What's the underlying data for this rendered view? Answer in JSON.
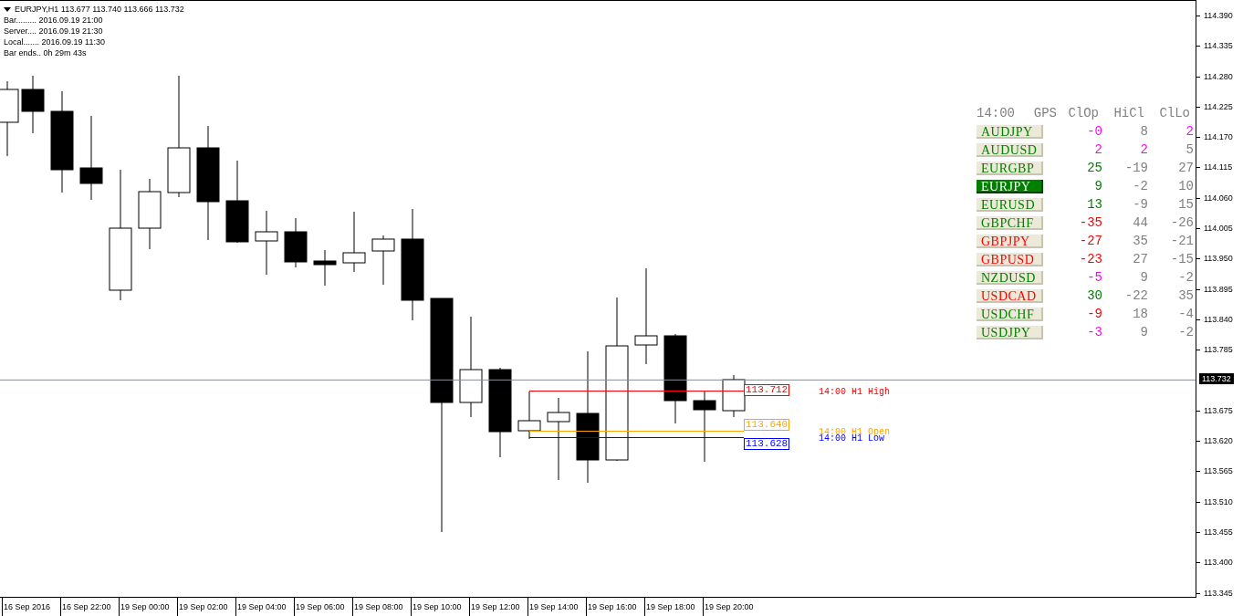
{
  "chart_header": {
    "title": "EURJPY,H1  113.677 113.740 113.666 113.732"
  },
  "info_lines": [
    "Bar......... 2016.09.19 21:00",
    "Server.... 2016.09.19 21:30",
    "Local....... 2016.09.19 11:30",
    "Bar ends.. 0h 29m 43s"
  ],
  "price_axis": {
    "labels": [
      "114.390",
      "114.335",
      "114.280",
      "114.225",
      "114.170",
      "114.115",
      "114.060",
      "114.005",
      "113.950",
      "113.895",
      "113.840",
      "113.785",
      "113.675",
      "113.620",
      "113.565",
      "113.510",
      "113.455",
      "113.400",
      "113.345"
    ],
    "current_price": "113.732"
  },
  "time_axis": [
    "16 Sep 2016",
    "16 Sep 22:00",
    "19 Sep 00:00",
    "19 Sep 02:00",
    "19 Sep 04:00",
    "19 Sep 06:00",
    "19 Sep 08:00",
    "19 Sep 10:00",
    "19 Sep 12:00",
    "19 Sep 14:00",
    "19 Sep 16:00",
    "19 Sep 18:00",
    "19 Sep 20:00"
  ],
  "levels": [
    {
      "price": "113.712",
      "label": "14:00 H1 High",
      "color": "#ff0000"
    },
    {
      "price": "113.640",
      "label": "14:00 H1 Open",
      "color": "#ffa500"
    },
    {
      "price": "113.628",
      "label": "14:00 H1 Low",
      "color": "#0000ff"
    }
  ],
  "panel": {
    "header": [
      "14:00",
      "GPS",
      "ClOp",
      "HiCl",
      "ClLo"
    ],
    "rows": [
      {
        "symbol": "AUDJPY",
        "color": "#008000",
        "selected": false,
        "values": [
          {
            "text": "-0",
            "color": "#ff00ff"
          },
          {
            "text": "8",
            "color": "#808080"
          },
          {
            "text": "2",
            "color": "#ff00ff"
          }
        ]
      },
      {
        "symbol": "AUDUSD",
        "color": "#008000",
        "selected": false,
        "values": [
          {
            "text": "2",
            "color": "#ff00ff"
          },
          {
            "text": "2",
            "color": "#ff00ff"
          },
          {
            "text": "5",
            "color": "#808080"
          }
        ]
      },
      {
        "symbol": "EURGBP",
        "color": "#008000",
        "selected": false,
        "values": [
          {
            "text": "25",
            "color": "#008000"
          },
          {
            "text": "-19",
            "color": "#808080"
          },
          {
            "text": "27",
            "color": "#808080"
          }
        ]
      },
      {
        "symbol": "EURJPY",
        "color": "#008000",
        "selected": true,
        "values": [
          {
            "text": "9",
            "color": "#008000"
          },
          {
            "text": "-2",
            "color": "#808080"
          },
          {
            "text": "10",
            "color": "#808080"
          }
        ]
      },
      {
        "symbol": "EURUSD",
        "color": "#008000",
        "selected": false,
        "values": [
          {
            "text": "13",
            "color": "#008000"
          },
          {
            "text": "-9",
            "color": "#808080"
          },
          {
            "text": "15",
            "color": "#808080"
          }
        ]
      },
      {
        "symbol": "GBPCHF",
        "color": "#008000",
        "selected": false,
        "values": [
          {
            "text": "-35",
            "color": "#ff0000"
          },
          {
            "text": "44",
            "color": "#808080"
          },
          {
            "text": "-26",
            "color": "#808080"
          }
        ]
      },
      {
        "symbol": "GBPJPY",
        "color": "#ff0000",
        "selected": false,
        "values": [
          {
            "text": "-27",
            "color": "#ff0000"
          },
          {
            "text": "35",
            "color": "#808080"
          },
          {
            "text": "-21",
            "color": "#808080"
          }
        ]
      },
      {
        "symbol": "GBPUSD",
        "color": "#ff0000",
        "selected": false,
        "values": [
          {
            "text": "-23",
            "color": "#ff0000"
          },
          {
            "text": "27",
            "color": "#808080"
          },
          {
            "text": "-15",
            "color": "#808080"
          }
        ]
      },
      {
        "symbol": "NZDUSD",
        "color": "#008000",
        "selected": false,
        "values": [
          {
            "text": "-5",
            "color": "#ff00ff"
          },
          {
            "text": "9",
            "color": "#808080"
          },
          {
            "text": "-2",
            "color": "#808080"
          }
        ]
      },
      {
        "symbol": "USDCAD",
        "color": "#ff0000",
        "selected": false,
        "values": [
          {
            "text": "30",
            "color": "#008000"
          },
          {
            "text": "-22",
            "color": "#808080"
          },
          {
            "text": "35",
            "color": "#808080"
          }
        ]
      },
      {
        "symbol": "USDCHF",
        "color": "#008000",
        "selected": false,
        "values": [
          {
            "text": "-9",
            "color": "#ff0000"
          },
          {
            "text": "18",
            "color": "#808080"
          },
          {
            "text": "-4",
            "color": "#808080"
          }
        ]
      },
      {
        "symbol": "USDJPY",
        "color": "#008000",
        "selected": false,
        "values": [
          {
            "text": "-3",
            "color": "#ff00ff"
          },
          {
            "text": "9",
            "color": "#808080"
          },
          {
            "text": "-2",
            "color": "#808080"
          }
        ]
      }
    ]
  }
}
